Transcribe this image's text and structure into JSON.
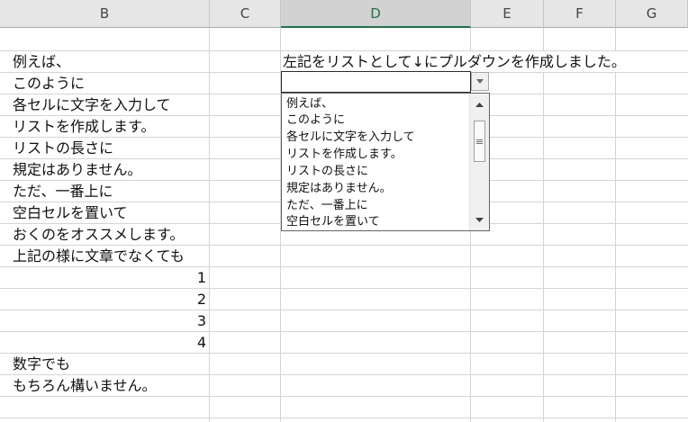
{
  "columns": [
    {
      "letter": "B"
    },
    {
      "letter": "C"
    },
    {
      "letter": "D"
    },
    {
      "letter": "E"
    },
    {
      "letter": "F"
    },
    {
      "letter": "G"
    }
  ],
  "column_b": {
    "rows": [
      {
        "text": ""
      },
      {
        "text": "例えば、"
      },
      {
        "text": "このように"
      },
      {
        "text": "各セルに文字を入力して"
      },
      {
        "text": "リストを作成します。"
      },
      {
        "text": "リストの長さに"
      },
      {
        "text": "規定はありません。"
      },
      {
        "text": "ただ、一番上に"
      },
      {
        "text": "空白セルを置いて"
      },
      {
        "text": "おくのをオススメします。"
      },
      {
        "text": "上記の様に文章でなくても"
      },
      {
        "text": "1"
      },
      {
        "text": "2"
      },
      {
        "text": "3"
      },
      {
        "text": "4"
      },
      {
        "text": "数字でも"
      },
      {
        "text": "もちろん構いません。"
      },
      {
        "text": ""
      }
    ]
  },
  "column_d": {
    "note": "左記をリストとして↓にプルダウンを作成しました。",
    "dropdown_value": ""
  },
  "dropdown_list": {
    "items": [
      "例えば、",
      "このように",
      "各セルに文字を入力して",
      "リストを作成します。",
      "リストの長さに",
      "規定はありません。",
      "ただ、一番上に",
      "空白セルを置いて"
    ]
  },
  "colors": {
    "selected_header_accent": "#217346",
    "gridline": "#d4d4d4"
  },
  "icons": {
    "dropdown_button": "triangle-down-icon",
    "scroll_up": "triangle-up-icon",
    "scroll_down": "triangle-down-icon",
    "scroll_thumb": "grip-icon"
  }
}
